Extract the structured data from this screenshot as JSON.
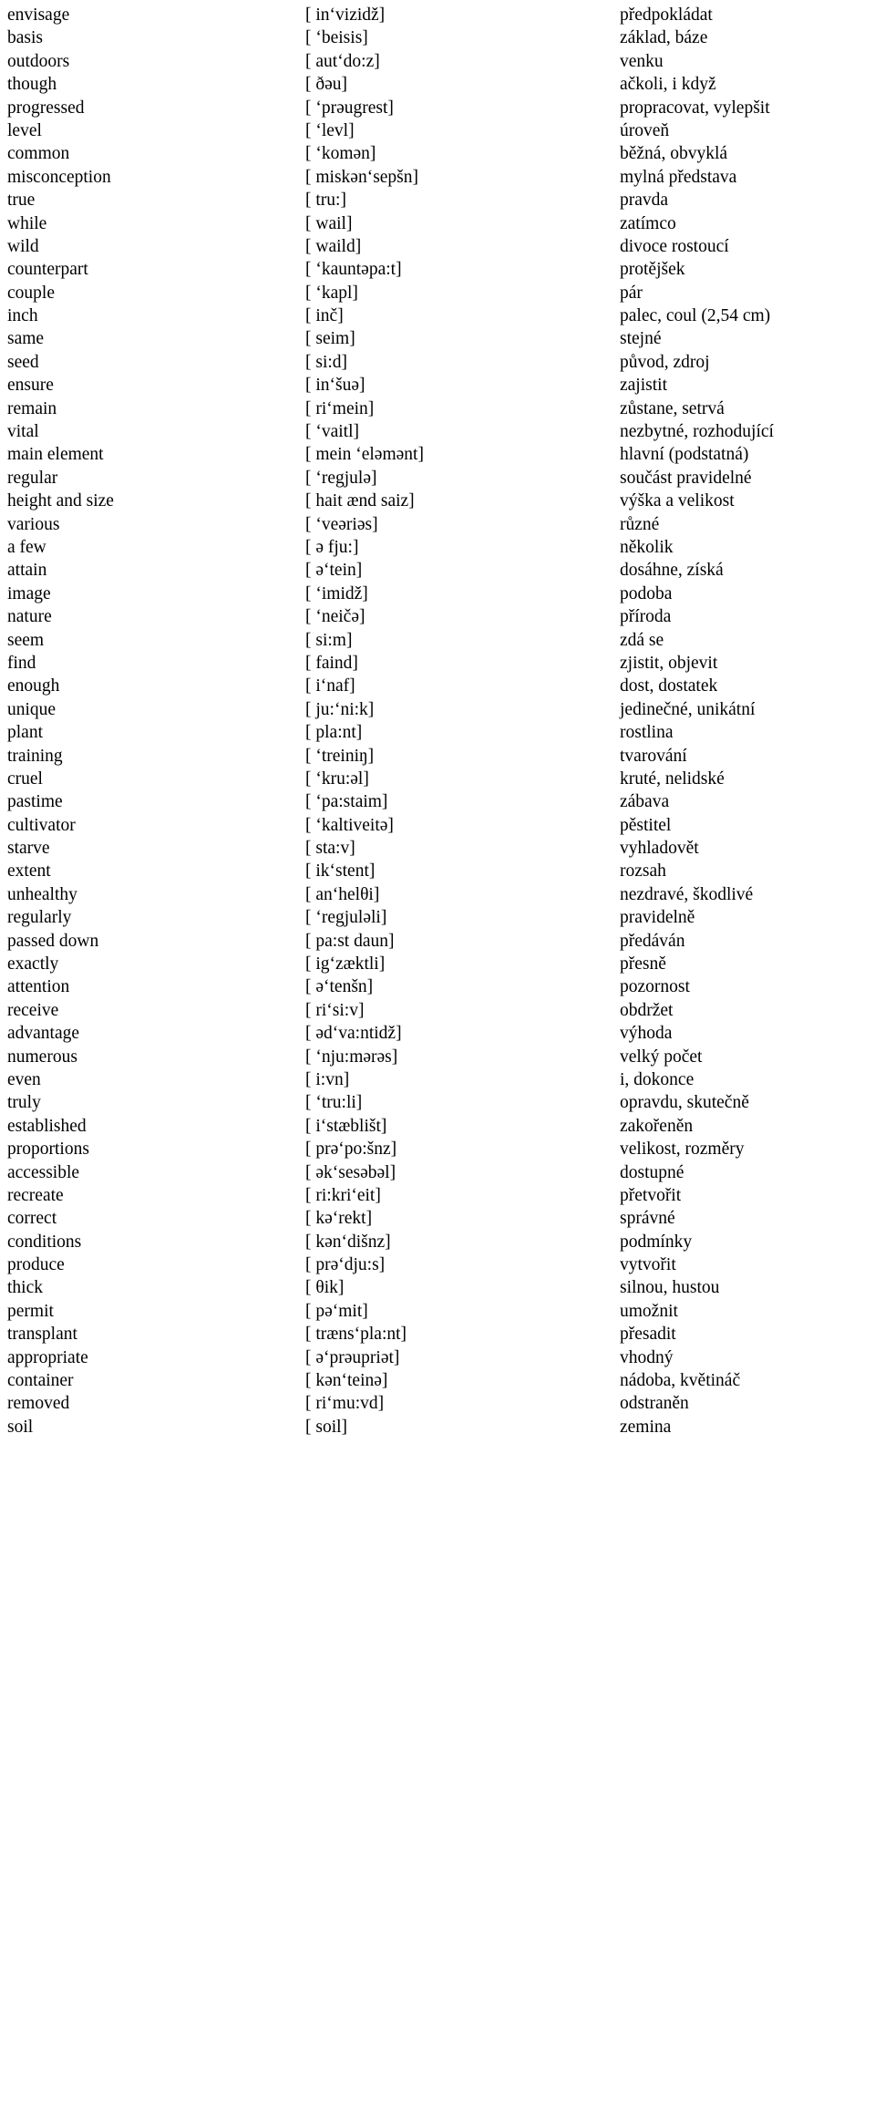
{
  "document": {
    "type": "vocabulary-list",
    "columns": [
      "english",
      "phonetic",
      "czech"
    ],
    "entries": [
      {
        "english": "envisage",
        "phonetic": "[ inʻvizidž]",
        "czech": "předpokládat"
      },
      {
        "english": "basis",
        "phonetic": "[ ʻbeisis]",
        "czech": "základ, báze"
      },
      {
        "english": "outdoors",
        "phonetic": "[ autʻdo:z]",
        "czech": "venku"
      },
      {
        "english": "though",
        "phonetic": "[ ðəu]",
        "czech": "ačkoli, i když"
      },
      {
        "english": "progressed",
        "phonetic": "[ ʻprəugrest]",
        "czech": "propracovat, vylepšit"
      },
      {
        "english": "level",
        "phonetic": "[ ʻlevl]",
        "czech": "úroveň"
      },
      {
        "english": "common",
        "phonetic": "[ ʻkomən]",
        "czech": "běžná, obvyklá"
      },
      {
        "english": "misconception",
        "phonetic": "[ miskənʻsepšn]",
        "czech": "mylná představa"
      },
      {
        "english": "true",
        "phonetic": "[ tru:]",
        "czech": "pravda"
      },
      {
        "english": "while",
        "phonetic": "[ wail]",
        "czech": "zatímco"
      },
      {
        "english": "wild",
        "phonetic": "[ waild]",
        "czech": "divoce rostoucí"
      },
      {
        "english": "counterpart",
        "phonetic": "[ ʻkauntəpa:t]",
        "czech": "protějšek"
      },
      {
        "english": "couple",
        "phonetic": "[ ʻkapl]",
        "czech": "pár"
      },
      {
        "english": "inch",
        "phonetic": "[ inč]",
        "czech": "palec, coul (2,54 cm)"
      },
      {
        "english": "same",
        "phonetic": "[ seim]",
        "czech": "stejné"
      },
      {
        "english": "seed",
        "phonetic": "[ si:d]",
        "czech": "původ, zdroj"
      },
      {
        "english": "ensure",
        "phonetic": "[ inʻšuə]",
        "czech": "zajistit"
      },
      {
        "english": "remain",
        "phonetic": "[ riʻmein]",
        "czech": "zůstane, setrvá"
      },
      {
        "english": "vital",
        "phonetic": "[ ʻvaitl]",
        "czech": "nezbytné, rozhodující"
      },
      {
        "english": "main element",
        "phonetic": "[ mein ʻeləmənt]",
        "czech": "hlavní (podstatná)"
      },
      {
        "english": "regular",
        "phonetic": "[ ʻregjulə]",
        "czech": "součást pravidelné"
      },
      {
        "english": "height and size",
        "phonetic": "[ hait ænd saiz]",
        "czech": "výška a velikost"
      },
      {
        "english": "various",
        "phonetic": "[ ʻveəriəs]",
        "czech": "různé"
      },
      {
        "english": "a few",
        "phonetic": "[ ə fju:]",
        "czech": "několik"
      },
      {
        "english": "attain",
        "phonetic": "[ əʻtein]",
        "czech": "dosáhne, získá"
      },
      {
        "english": "image",
        "phonetic": "[ ʻimidž]",
        "czech": "podoba"
      },
      {
        "english": "nature",
        "phonetic": "[ ʻneičə]",
        "czech": "příroda"
      },
      {
        "english": "seem",
        "phonetic": "[ si:m]",
        "czech": "zdá se"
      },
      {
        "english": "find",
        "phonetic": "[ faind]",
        "czech": "zjistit, objevit"
      },
      {
        "english": "enough",
        "phonetic": "[ iʻnaf]",
        "czech": "dost, dostatek"
      },
      {
        "english": "unique",
        "phonetic": "[ ju:ʻni:k]",
        "czech": "jedinečné, unikátní"
      },
      {
        "english": "plant",
        "phonetic": "[ pla:nt]",
        "czech": "rostlina"
      },
      {
        "english": "training",
        "phonetic": "[ ʻtreiniŋ]",
        "czech": "tvarování"
      },
      {
        "english": "cruel",
        "phonetic": "[ ʻkru:əl]",
        "czech": "kruté, nelidské"
      },
      {
        "english": "pastime",
        "phonetic": "[ ʻpa:staim]",
        "czech": "zábava"
      },
      {
        "english": "cultivator",
        "phonetic": "[ ʻkaltiveitə]",
        "czech": "pěstitel"
      },
      {
        "english": "starve",
        "phonetic": "[ sta:v]",
        "czech": "vyhladovět"
      },
      {
        "english": "extent",
        "phonetic": "[ ikʻstent]",
        "czech": "rozsah"
      },
      {
        "english": "unhealthy",
        "phonetic": "[ anʻhelθi]",
        "czech": "nezdravé, škodlivé"
      },
      {
        "english": "regularly",
        "phonetic": "[ ʻregjuləli]",
        "czech": "pravidelně"
      },
      {
        "english": "passed down",
        "phonetic": "[ pa:st daun]",
        "czech": "předáván"
      },
      {
        "english": "exactly",
        "phonetic": "[ igʻzæktli]",
        "czech": "přesně"
      },
      {
        "english": "attention",
        "phonetic": "[ əʻtenšn]",
        "czech": "pozornost"
      },
      {
        "english": "receive",
        "phonetic": "[ riʻsi:v]",
        "czech": "obdržet"
      },
      {
        "english": "advantage",
        "phonetic": "[ ədʻva:ntidž]",
        "czech": "výhoda"
      },
      {
        "english": "numerous",
        "phonetic": "[ ʻnju:mərəs]",
        "czech": "velký počet"
      },
      {
        "english": "even",
        "phonetic": "[ i:vn]",
        "czech": "i, dokonce"
      },
      {
        "english": "truly",
        "phonetic": "[ ʻtru:li]",
        "czech": "opravdu, skutečně"
      },
      {
        "english": "established",
        "phonetic": "[ iʻstæblišt]",
        "czech": "zakořeněn"
      },
      {
        "english": "proportions",
        "phonetic": "[ prəʻpo:šnz]",
        "czech": "velikost, rozměry"
      },
      {
        "english": "accessible",
        "phonetic": "[ əkʻsesəbəl]",
        "czech": "dostupné"
      },
      {
        "english": "recreate",
        "phonetic": "[ ri:kriʻeit]",
        "czech": "přetvořit"
      },
      {
        "english": "correct",
        "phonetic": "[ kəʻrekt]",
        "czech": "správné"
      },
      {
        "english": "conditions",
        "phonetic": "[ kənʻdišnz]",
        "czech": "podmínky"
      },
      {
        "english": "produce",
        "phonetic": "[ prəʻdju:s]",
        "czech": "vytvořit"
      },
      {
        "english": "thick",
        "phonetic": "[ θik]",
        "czech": "silnou, hustou"
      },
      {
        "english": "permit",
        "phonetic": "[ pəʻmit]",
        "czech": "umožnit"
      },
      {
        "english": "transplant",
        "phonetic": "[ trænsʻpla:nt]",
        "czech": "přesadit"
      },
      {
        "english": "appropriate",
        "phonetic": "[ əʻprəupriət]",
        "czech": "vhodný"
      },
      {
        "english": "container",
        "phonetic": "[ kənʻteinə]",
        "czech": "nádoba, květináč"
      },
      {
        "english": "removed",
        "phonetic": "[ riʻmu:vd]",
        "czech": "odstraněn"
      },
      {
        "english": "soil",
        "phonetic": "[ soil]",
        "czech": "zemina"
      }
    ]
  }
}
